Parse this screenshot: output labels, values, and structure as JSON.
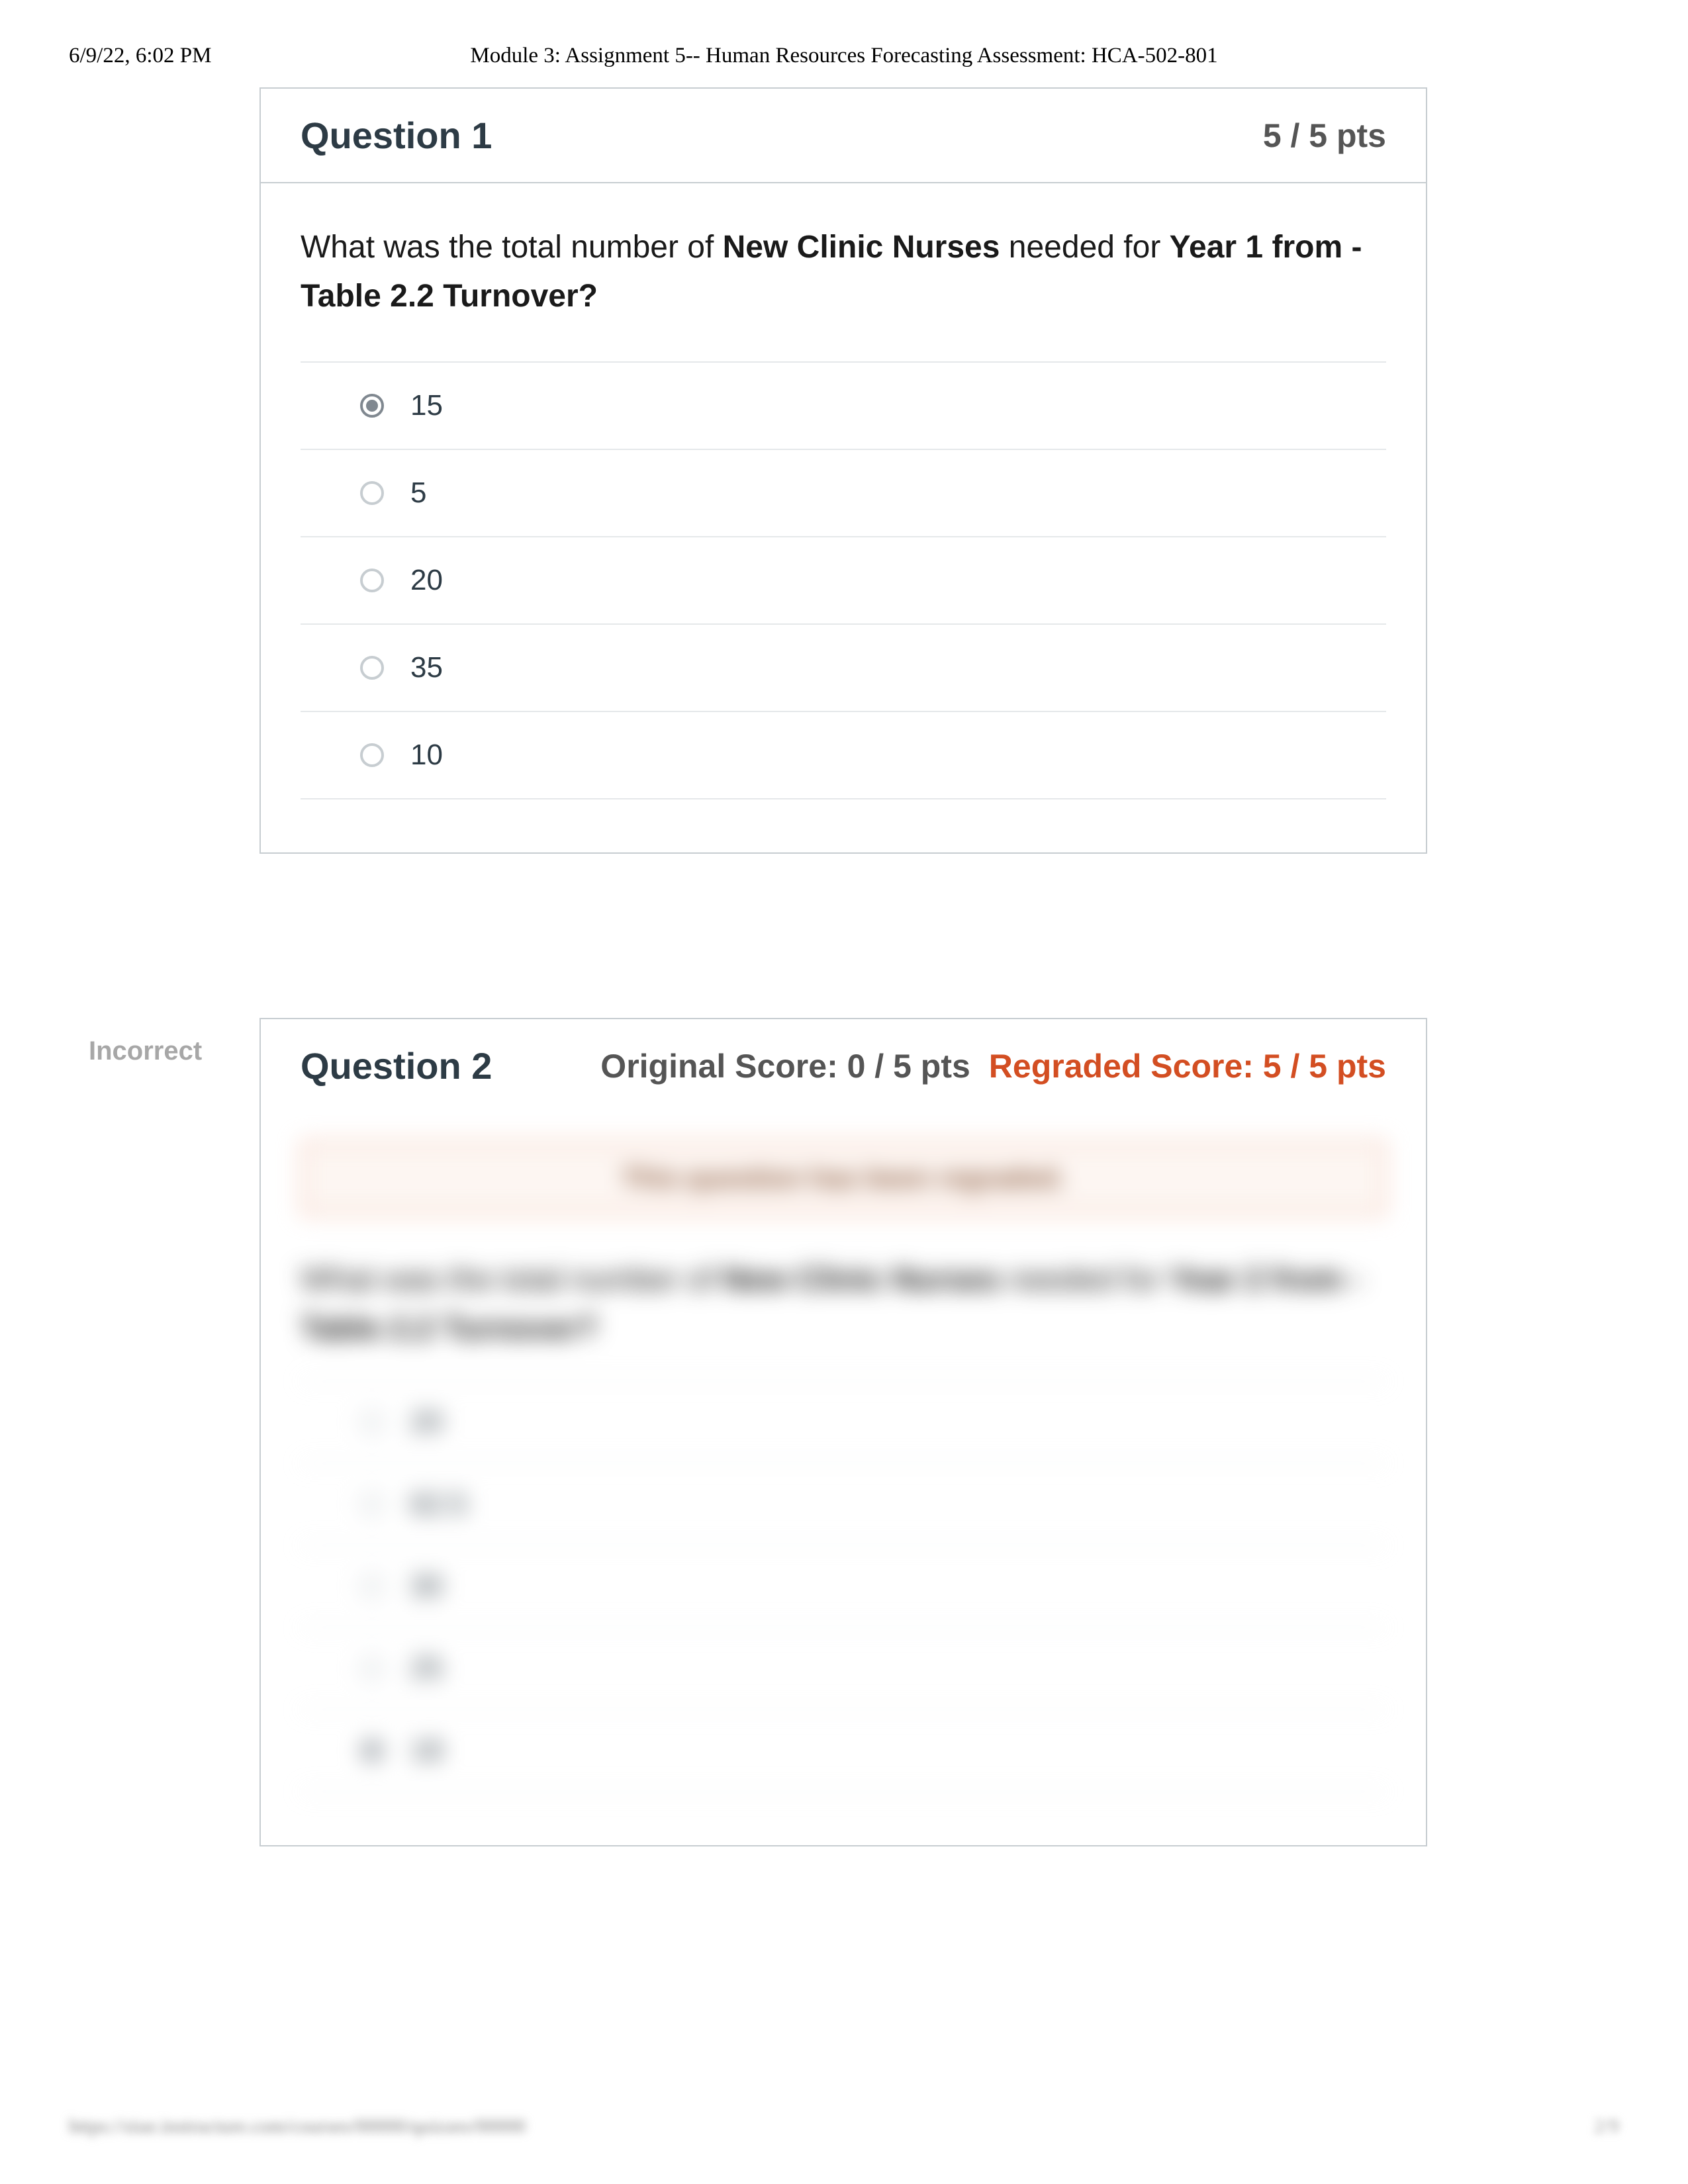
{
  "header": {
    "timestamp": "6/9/22, 6:02 PM",
    "title": "Module 3: Assignment 5-- Human Resources Forecasting Assessment: HCA-502-801"
  },
  "q1": {
    "title": "Question 1",
    "points": "5 / 5 pts",
    "stem_pre": "What was the total number of ",
    "stem_b1": "New Clinic Nurses",
    "stem_mid": " needed for ",
    "stem_b2": "Year 1 from - Table 2.2 Turnover?",
    "answers": [
      "15",
      "5",
      "20",
      "35",
      "10"
    ],
    "selected_index": 0
  },
  "q2": {
    "label": "Incorrect",
    "title": "Question 2",
    "score_original": "Original Score: 0 / 5 pts",
    "score_regraded": "Regraded Score: 5 / 5 pts",
    "banner": "This question has been regraded.",
    "stem_pre": "What was the total number of ",
    "stem_b1": "New Clinic Nurses",
    "stem_mid": " needed for ",
    "stem_b2": "Year 2 from - Table 2.2 Turnover?",
    "answers": [
      "20",
      "62.5",
      "30",
      "25",
      "18"
    ],
    "selected_index": 4
  },
  "footer": {
    "url": "https://siue.instructure.com/courses/00000/quizzes/00000",
    "page": "2/9"
  }
}
